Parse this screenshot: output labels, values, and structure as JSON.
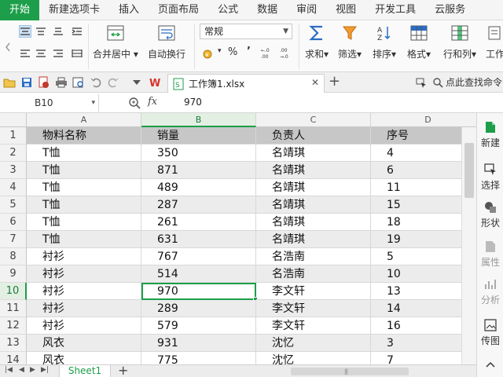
{
  "menu": {
    "tabs": [
      {
        "label": "开始",
        "active": true
      },
      {
        "label": "新建选项卡"
      },
      {
        "label": "插入"
      },
      {
        "label": "页面布局"
      },
      {
        "label": "公式"
      },
      {
        "label": "数据"
      },
      {
        "label": "审阅"
      },
      {
        "label": "视图"
      },
      {
        "label": "开发工具"
      },
      {
        "label": "云服务"
      }
    ]
  },
  "ribbon": {
    "merge_label": "合并居中",
    "wrap_label": "自动换行",
    "number_format": "常规",
    "percent_symbol": "%",
    "comma_symbol": "’",
    "sum_label": "求和",
    "filter_label": "筛选",
    "sort_label": "排序",
    "format_label": "格式",
    "rowcol_label": "行和列",
    "worksheet_label": "工作"
  },
  "doc": {
    "filename": "工作簿1.xlsx",
    "search_label": "点此查找命令"
  },
  "formula": {
    "namebox": "B10",
    "fx": "fx",
    "value": "970"
  },
  "grid": {
    "columns": [
      "A",
      "B",
      "C",
      "D"
    ],
    "rows": [
      "1",
      "2",
      "3",
      "4",
      "5",
      "6",
      "7",
      "8",
      "9",
      "10",
      "11",
      "12",
      "13",
      "14"
    ],
    "selected_row": "10",
    "selected_col": "B",
    "cells": [
      [
        "物料名称",
        "销量",
        "负责人",
        "序号"
      ],
      [
        "T恤",
        "350",
        "名靖琪",
        "4"
      ],
      [
        "T恤",
        "871",
        "名靖琪",
        "6"
      ],
      [
        "T恤",
        "489",
        "名靖琪",
        "11"
      ],
      [
        "T恤",
        "287",
        "名靖琪",
        "15"
      ],
      [
        "T恤",
        "261",
        "名靖琪",
        "18"
      ],
      [
        "T恤",
        "631",
        "名靖琪",
        "19"
      ],
      [
        "衬衫",
        "767",
        "名浩南",
        "5"
      ],
      [
        "衬衫",
        "514",
        "名浩南",
        "10"
      ],
      [
        "衬衫",
        "970",
        "李文轩",
        "13"
      ],
      [
        "衬衫",
        "289",
        "李文轩",
        "14"
      ],
      [
        "衬衫",
        "579",
        "李文轩",
        "16"
      ],
      [
        "风衣",
        "931",
        "沈忆",
        "3"
      ],
      [
        "风衣",
        "775",
        "沈忆",
        "7"
      ]
    ]
  },
  "sidepanel": {
    "items": [
      {
        "label": "新建"
      },
      {
        "label": "选择"
      },
      {
        "label": "形状"
      },
      {
        "label": "属性"
      },
      {
        "label": "分析"
      },
      {
        "label": "传图"
      }
    ]
  },
  "sheets": {
    "tabs": [
      "Sheet1"
    ]
  },
  "colors": {
    "accent": "#1d9e4a",
    "header_fill": "#c7c7c7",
    "alt_row_fill": "#ececec"
  }
}
